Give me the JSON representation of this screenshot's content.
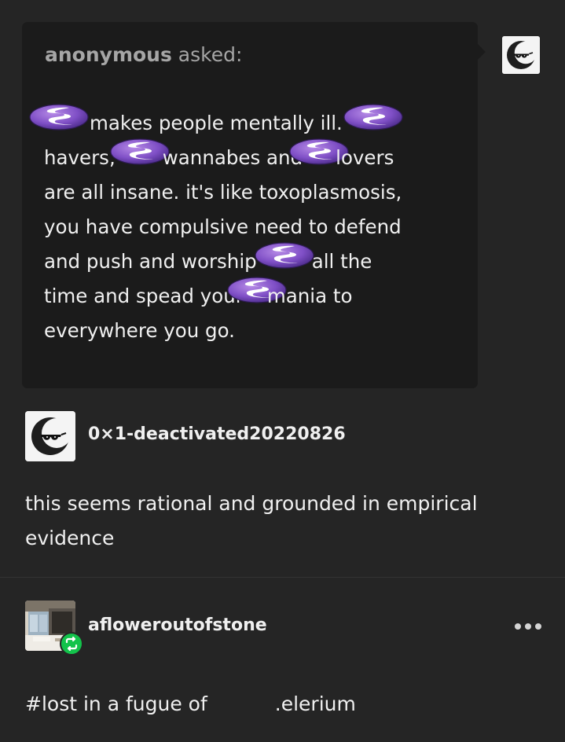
{
  "ask": {
    "asker_name": "anonymous",
    "asked_suffix": " asked:",
    "lines": [
      [
        "",
        "makes people mentally ill.",
        ""
      ],
      [
        "havers,",
        "wannabes and",
        "lovers"
      ],
      [
        "are all insane. it's like toxoplasmosis,"
      ],
      [
        "you have compulsive need to defend"
      ],
      [
        "and push and worship",
        "all the"
      ],
      [
        "time and spead your",
        "mania to"
      ],
      [
        "everywhere you go."
      ]
    ],
    "emoji_name": "emacs-logo-icon"
  },
  "answer": {
    "username": "0×1-deactivated20220826",
    "text": "this seems rational and grounded in empirical evidence"
  },
  "reblog": {
    "username": "afloweroutofstone",
    "tag_prefix": "#lost in a fugue of",
    "tag_suffix": ".elerium"
  },
  "colors": {
    "background": "#252525",
    "ask_bubble": "#1b1b1b",
    "emoji_purple": "#7f4fc6",
    "reblog_green": "#13c34b"
  }
}
